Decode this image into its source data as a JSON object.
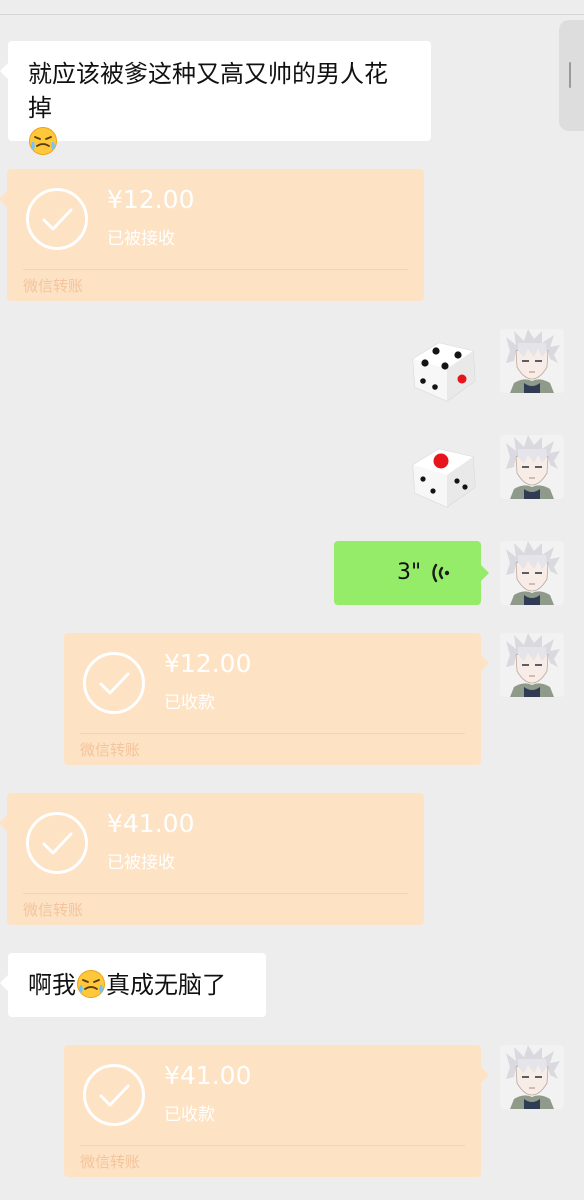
{
  "messages": {
    "m1": {
      "text": "就应该被爹这种又高又帅的男人花掉",
      "emoji": "sweat-angry-emoji"
    },
    "t1": {
      "amount": "¥12.00",
      "status": "已被接收",
      "footer": "微信转账"
    },
    "d1": {
      "icon": "dice-four-icon",
      "face": 4
    },
    "d2": {
      "icon": "dice-one-icon",
      "face": 1
    },
    "voice": {
      "duration": "3\"",
      "icon": "voice-wave-icon"
    },
    "t2": {
      "amount": "¥12.00",
      "status": "已收款",
      "footer": "微信转账"
    },
    "t3": {
      "amount": "¥41.00",
      "status": "已被接收",
      "footer": "微信转账"
    },
    "m2": {
      "prefix": "啊我",
      "suffix": "真成无脑了",
      "emoji": "sweat-angry-emoji"
    },
    "t4": {
      "amount": "¥41.00",
      "status": "已收款",
      "footer": "微信转账"
    }
  },
  "colors": {
    "background": "#ededed",
    "transfer": "#fde2c4",
    "voice_bubble": "#95ec69",
    "dice_red": "#e8141b"
  }
}
